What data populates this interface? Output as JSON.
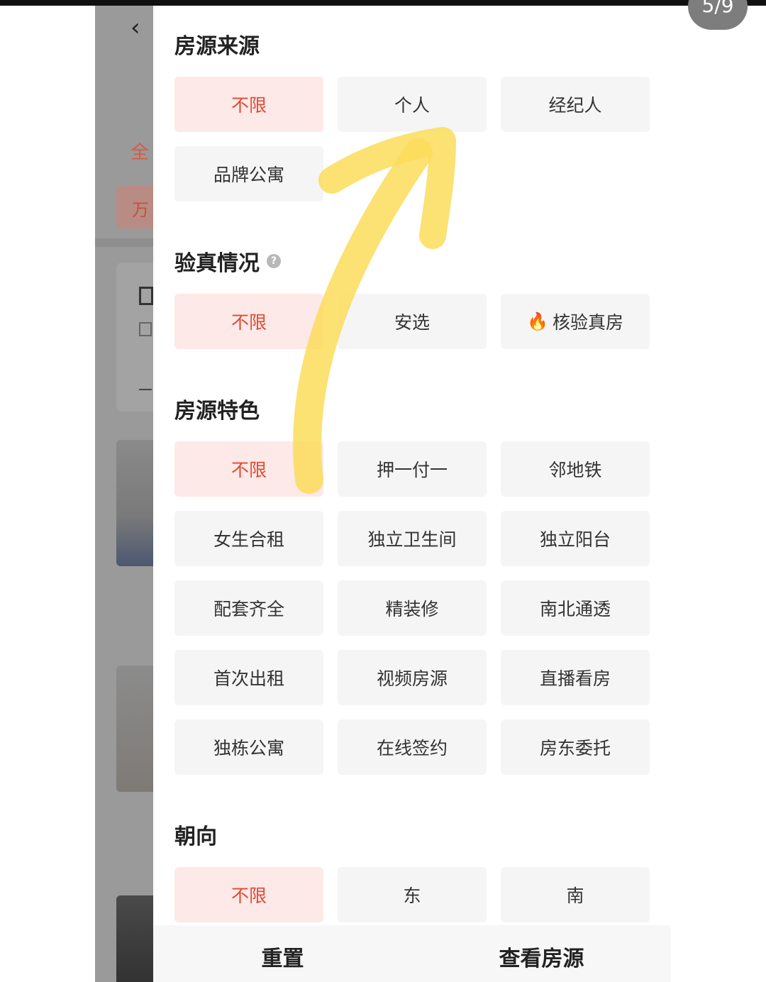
{
  "page_indicator": "5/9",
  "background": {
    "all_tab": "全",
    "chip_text": "万"
  },
  "sections": {
    "source": {
      "title": "房源来源",
      "options": [
        "不限",
        "个人",
        "经纪人",
        "品牌公寓"
      ]
    },
    "verify": {
      "title": "验真情况",
      "options": [
        "不限",
        "安选",
        "核验真房"
      ]
    },
    "features": {
      "title": "房源特色",
      "options": [
        "不限",
        "押一付一",
        "邻地铁",
        "女生合租",
        "独立卫生间",
        "独立阳台",
        "配套齐全",
        "精装修",
        "南北通透",
        "首次出租",
        "视频房源",
        "直播看房",
        "独栋公寓",
        "在线签约",
        "房东委托"
      ]
    },
    "orientation": {
      "title": "朝向",
      "options": [
        "不限",
        "东",
        "南"
      ]
    }
  },
  "footer": {
    "reset_label": "重置",
    "view_label": "查看房源"
  },
  "colors": {
    "accent": "#e04a33",
    "selected_bg": "#fde9e7",
    "option_bg": "#f5f5f5",
    "annotation": "#fbdc5a"
  }
}
